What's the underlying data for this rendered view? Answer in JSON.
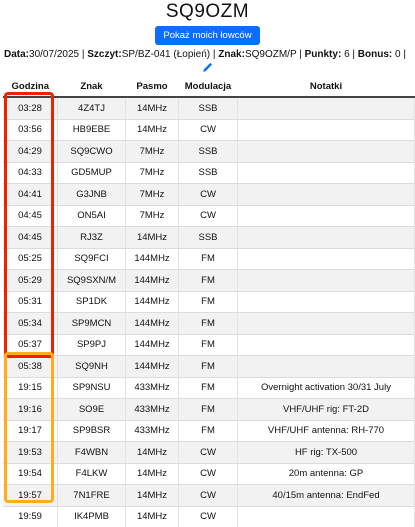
{
  "page": {
    "title": "SQ9OZM",
    "show_hunters_button": "Pokaż moich łowców"
  },
  "info": {
    "date_label": "Data:",
    "date_value": "30/07/2025",
    "summit_label": "Szczyt:",
    "summit_value": "SP/BZ-041 (Łopień)",
    "sign_label": "Znak:",
    "sign_value": "SQ9OZM/P",
    "points_label": "Punkty:",
    "points_value": "6",
    "bonus_label": "Bonus:",
    "bonus_value": "0",
    "sep": "|"
  },
  "edit_icon": "pencil-icon",
  "table": {
    "headers": [
      "Godzina",
      "Znak",
      "Pasmo",
      "Modulacja",
      "Notatki"
    ],
    "rows": [
      [
        "03:28",
        "4Z4TJ",
        "14MHz",
        "SSB",
        ""
      ],
      [
        "03:56",
        "HB9EBE",
        "14MHz",
        "CW",
        ""
      ],
      [
        "04:29",
        "SQ9CWO",
        "7MHz",
        "SSB",
        ""
      ],
      [
        "04:33",
        "GD5MUP",
        "7MHz",
        "SSB",
        ""
      ],
      [
        "04:41",
        "G3JNB",
        "7MHz",
        "CW",
        ""
      ],
      [
        "04:45",
        "ON5AI",
        "7MHz",
        "CW",
        ""
      ],
      [
        "04:45",
        "RJ3Z",
        "14MHz",
        "SSB",
        ""
      ],
      [
        "05:25",
        "SQ9FCI",
        "144MHz",
        "FM",
        ""
      ],
      [
        "05:29",
        "SQ9SXN/M",
        "144MHz",
        "FM",
        ""
      ],
      [
        "05:31",
        "SP1DK",
        "144MHz",
        "FM",
        ""
      ],
      [
        "05:34",
        "SP9MCN",
        "144MHz",
        "FM",
        ""
      ],
      [
        "05:37",
        "SP9PJ",
        "144MHz",
        "FM",
        ""
      ],
      [
        "05:38",
        "SQ9NH",
        "144MHz",
        "FM",
        ""
      ],
      [
        "19:15",
        "SP9NSU",
        "433MHz",
        "FM",
        "Overnight activation 30/31 July"
      ],
      [
        "19:16",
        "SO9E",
        "433MHz",
        "FM",
        "VHF/UHF rig: FT-2D"
      ],
      [
        "19:17",
        "SP9BSR",
        "433MHz",
        "FM",
        "VHF/UHF antenna: RH-770"
      ],
      [
        "19:53",
        "F4WBN",
        "14MHz",
        "CW",
        "HF rig: TX-500"
      ],
      [
        "19:54",
        "F4LKW",
        "14MHz",
        "CW",
        "20m antenna: GP"
      ],
      [
        "19:57",
        "7N1FRE",
        "14MHz",
        "CW",
        "40/15m antenna: EndFed"
      ],
      [
        "19:59",
        "IK4PMB",
        "14MHz",
        "CW",
        ""
      ]
    ]
  },
  "colors": {
    "button": "#0d6efd",
    "highlight_morning": "#ee2200",
    "highlight_evening": "#ffae1a"
  }
}
